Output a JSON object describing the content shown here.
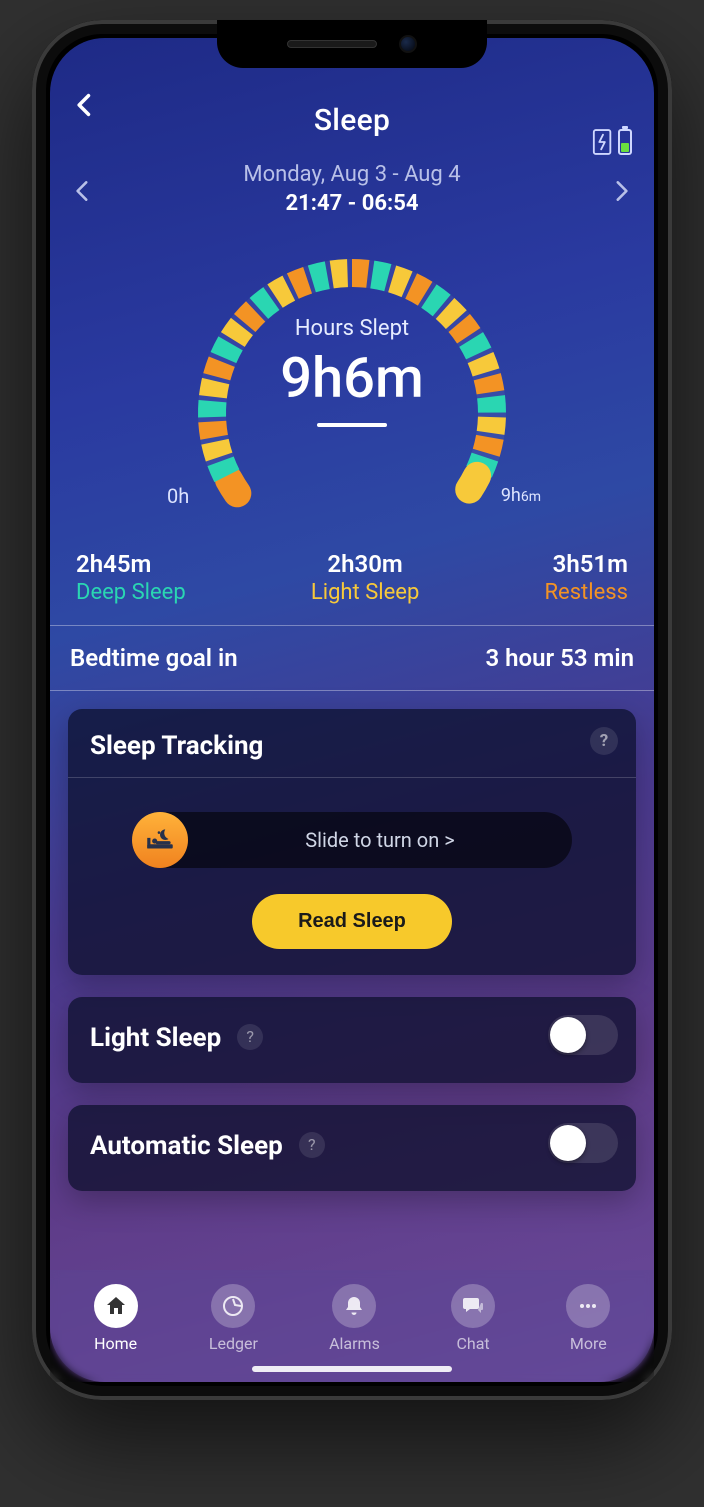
{
  "header": {
    "title": "Sleep"
  },
  "dateNav": {
    "date": "Monday, Aug 3 - Aug 4",
    "timespan": "21:47 - 06:54"
  },
  "gauge": {
    "label": "Hours Slept",
    "value": "9h6m",
    "start": "0h",
    "end_h": "9h",
    "end_m": "6m"
  },
  "breakdown": {
    "deep": {
      "value": "2h45m",
      "label": "Deep Sleep"
    },
    "light": {
      "value": "2h30m",
      "label": "Light Sleep"
    },
    "restless": {
      "value": "3h51m",
      "label": "Restless"
    }
  },
  "goal": {
    "label": "Bedtime goal in",
    "value": "3 hour 53 min"
  },
  "cards": {
    "tracking": {
      "title": "Sleep Tracking",
      "sliderText": "Slide to turn on >",
      "readBtn": "Read Sleep"
    },
    "lightSleep": {
      "title": "Light Sleep"
    },
    "autoSleep": {
      "title": "Automatic Sleep"
    }
  },
  "tabs": {
    "home": "Home",
    "ledger": "Ledger",
    "alarms": "Alarms",
    "chat": "Chat",
    "more": "More"
  },
  "chart_data": {
    "type": "pie",
    "title": "Hours Slept",
    "total_label": "9h6m",
    "series": [
      {
        "name": "Deep Sleep",
        "value_label": "2h45m",
        "minutes": 165,
        "color": "#2ad6b2"
      },
      {
        "name": "Light Sleep",
        "value_label": "2h30m",
        "minutes": 150,
        "color": "#f7c93a"
      },
      {
        "name": "Restless",
        "value_label": "3h51m",
        "minutes": 231,
        "color": "#f39324"
      }
    ],
    "range": {
      "start": "0h",
      "end": "9h6m"
    },
    "arc_degrees": 250
  }
}
